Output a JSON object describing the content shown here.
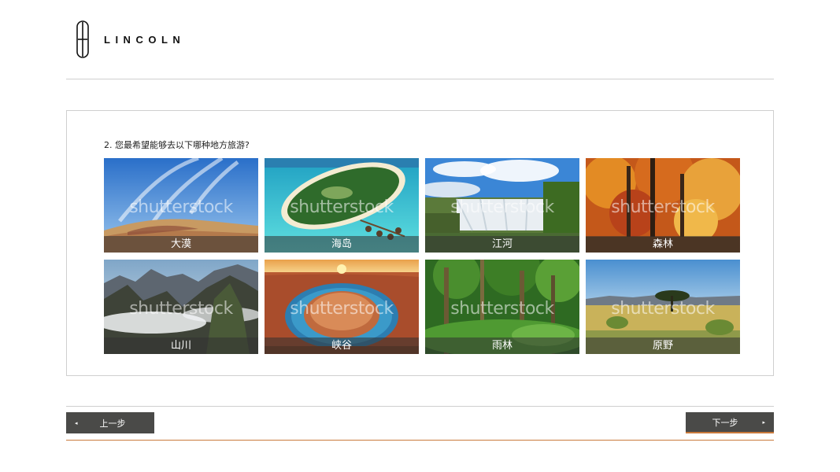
{
  "brand": {
    "name": "LINCOLN"
  },
  "question": {
    "text": "2. 您最希望能够去以下哪种地方旅游?"
  },
  "watermark": "shutterstock",
  "options": [
    {
      "label": "大漠",
      "icon": "desert-photo"
    },
    {
      "label": "海岛",
      "icon": "island-photo"
    },
    {
      "label": "江河",
      "icon": "waterfall-photo"
    },
    {
      "label": "森林",
      "icon": "autumn-forest-photo"
    },
    {
      "label": "山川",
      "icon": "mountains-photo"
    },
    {
      "label": "峡谷",
      "icon": "canyon-photo"
    },
    {
      "label": "雨林",
      "icon": "rainforest-photo"
    },
    {
      "label": "原野",
      "icon": "savanna-photo"
    }
  ],
  "nav": {
    "prev_label": "上一步",
    "next_label": "下一步",
    "prev_arrow": "◂",
    "next_arrow": "▸"
  },
  "colors": {
    "accent": "#c97a3c",
    "button_bg": "#4a4a48",
    "border": "#cfcfcf"
  }
}
